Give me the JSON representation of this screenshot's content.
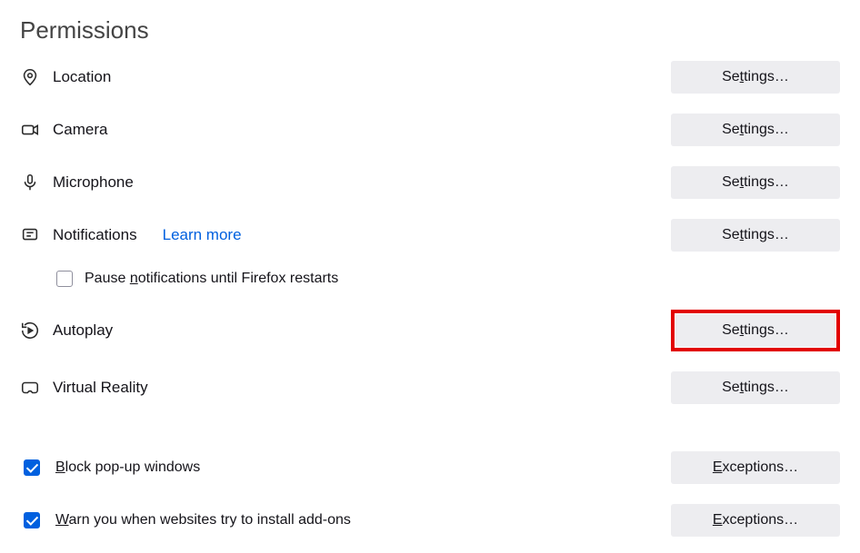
{
  "section_title": "Permissions",
  "rows": {
    "location": {
      "label": "Location"
    },
    "camera": {
      "label": "Camera"
    },
    "microphone": {
      "label": "Microphone"
    },
    "notifications": {
      "label": "Notifications",
      "learn_more": "Learn more"
    },
    "pause_notifications": {
      "pre": "Pause ",
      "ul": "n",
      "post": "otifications until Firefox restarts",
      "checked": false
    },
    "autoplay": {
      "label": "Autoplay"
    },
    "vr": {
      "label": "Virtual Reality"
    },
    "block_popups": {
      "ul": "B",
      "post": "lock pop-up windows",
      "checked": true
    },
    "warn_addons": {
      "ul": "W",
      "post": "arn you when websites try to install add-ons",
      "checked": true
    }
  },
  "buttons": {
    "settings": {
      "pre": "Se",
      "ul": "t",
      "post": "tings…"
    },
    "exceptions": {
      "ul": "E",
      "post": "xceptions…"
    }
  },
  "highlighted_row": "autoplay"
}
